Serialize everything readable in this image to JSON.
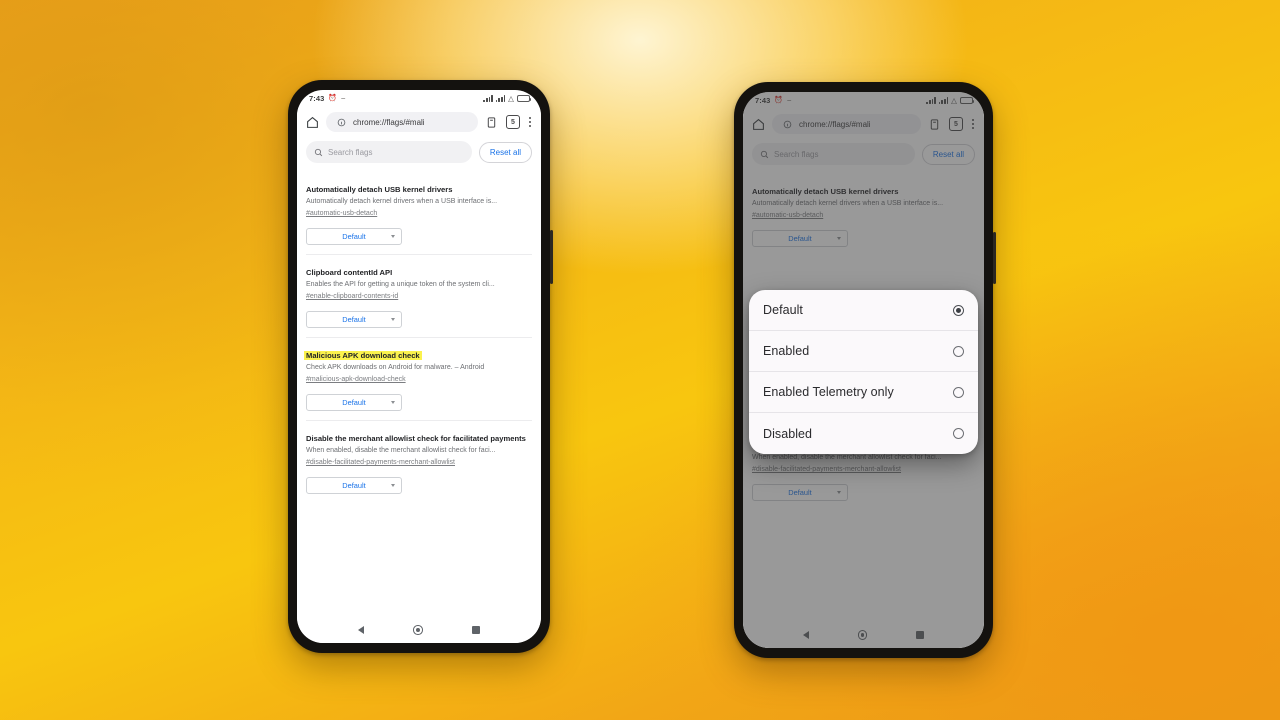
{
  "scene": {
    "background_colors": [
      "#eda01a",
      "#f4b516",
      "#f8c60f",
      "#e89a14"
    ],
    "highlight_color": "#fbf24d",
    "accent_color": "#1a73e8"
  },
  "phone_left": {
    "status_bar": {
      "time": "7:43",
      "icons": [
        "alarm-icon",
        "dash-icon",
        "signal-bars-icon",
        "wifi-icon",
        "battery-icon"
      ]
    },
    "toolbar": {
      "home_icon": "home-icon",
      "info_icon": "page-info-icon",
      "url": "chrome://flags/#mali",
      "tab_count": "5",
      "menu_icon": "overflow-menu-icon"
    },
    "search": {
      "placeholder": "Search flags",
      "reset_label": "Reset all"
    },
    "flags": [
      {
        "title": "Automatically detach USB kernel drivers",
        "description": "Automatically detach kernel drivers when a USB interface is...",
        "link": "#automatic-usb-detach",
        "value": "Default",
        "highlighted": false
      },
      {
        "title": "Clipboard contentId API",
        "description": "Enables the API for getting a unique token of the system cli...",
        "link": "#enable-clipboard-contents-id",
        "value": "Default",
        "highlighted": false
      },
      {
        "title": "Malicious APK download check",
        "description": "Check APK downloads on Android for malware. – Android",
        "link": "#malicious-apk-download-check",
        "value": "Default",
        "highlighted": true
      },
      {
        "title": "Disable the merchant allowlist check for facilitated payments",
        "description": "When enabled, disable the merchant allowlist check for faci...",
        "link": "#disable-facilitated-payments-merchant-allowlist",
        "value": "Default",
        "highlighted": false
      }
    ],
    "navbar": {
      "back": "back-nav-icon",
      "home": "home-nav-icon",
      "recents": "recents-nav-icon"
    }
  },
  "phone_right": {
    "status_bar": {
      "time": "7:43",
      "icons": [
        "alarm-icon",
        "dash-icon",
        "signal-bars-icon",
        "wifi-icon",
        "battery-icon"
      ]
    },
    "toolbar": {
      "home_icon": "home-icon",
      "info_icon": "page-info-icon",
      "url": "chrome://flags/#mali",
      "tab_count": "5",
      "menu_icon": "overflow-menu-icon"
    },
    "search": {
      "placeholder": "Search flags",
      "reset_label": "Reset all"
    },
    "flags": [
      {
        "title": "Automatically detach USB kernel drivers",
        "description": "Automatically detach kernel drivers when a USB interface is...",
        "link": "#automatic-usb-detach",
        "value": "Default",
        "highlighted": false
      },
      {
        "title": "Disable the merchant allowlist check for facilitated payments",
        "description": "When enabled, disable the merchant allowlist check for faci...",
        "link": "#disable-facilitated-payments-merchant-allowlist",
        "value": "Default",
        "highlighted": false
      }
    ],
    "dialog": {
      "options": [
        {
          "label": "Default",
          "selected": true
        },
        {
          "label": "Enabled",
          "selected": false
        },
        {
          "label": "Enabled Telemetry only",
          "selected": false
        },
        {
          "label": "Disabled",
          "selected": false
        }
      ]
    },
    "navbar": {
      "back": "back-nav-icon",
      "home": "home-nav-icon",
      "recents": "recents-nav-icon"
    }
  }
}
